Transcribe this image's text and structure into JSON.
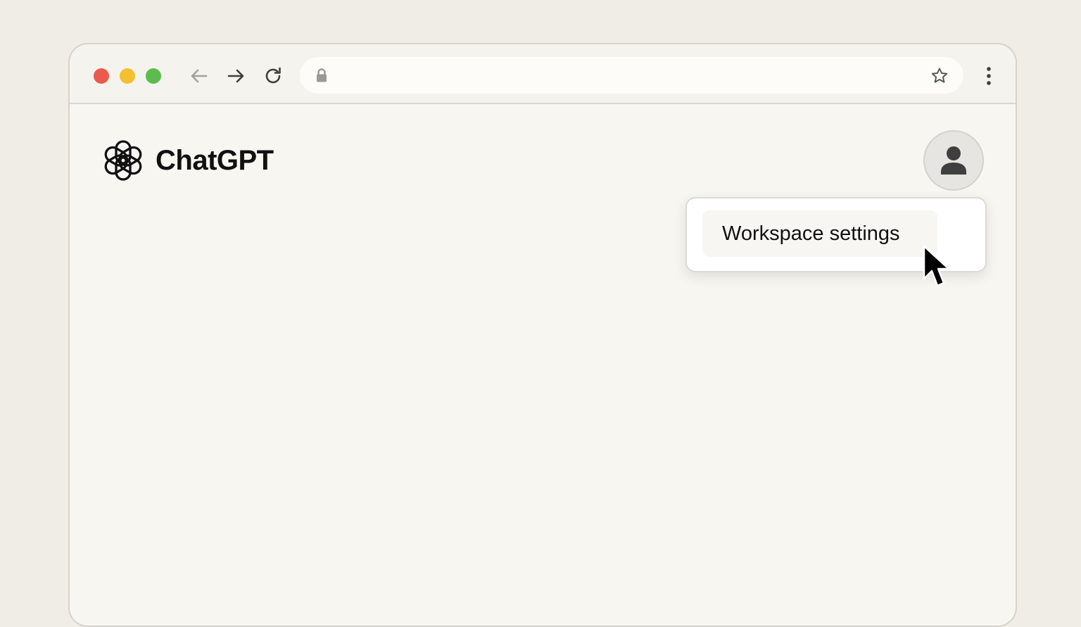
{
  "browser": {
    "address_text": "",
    "traffic_lights": {
      "close": "#ea5b4d",
      "minimize": "#f5c02f",
      "maximize": "#5cbc4f"
    },
    "icons": {
      "back": "arrow-left-icon",
      "forward": "arrow-right-icon",
      "reload": "reload-icon",
      "lock": "lock-icon",
      "bookmark": "star-icon",
      "menu": "kebab-menu-icon"
    }
  },
  "app": {
    "name": "ChatGPT",
    "logo_icon": "openai-logo-icon"
  },
  "user_menu": {
    "avatar_icon": "user-icon",
    "items": [
      {
        "label": "Workspace settings",
        "state": "hovered"
      }
    ]
  },
  "colors": {
    "page_background": "#f8f6f1",
    "desktop_background": "#efede6",
    "text_primary": "#111111"
  }
}
